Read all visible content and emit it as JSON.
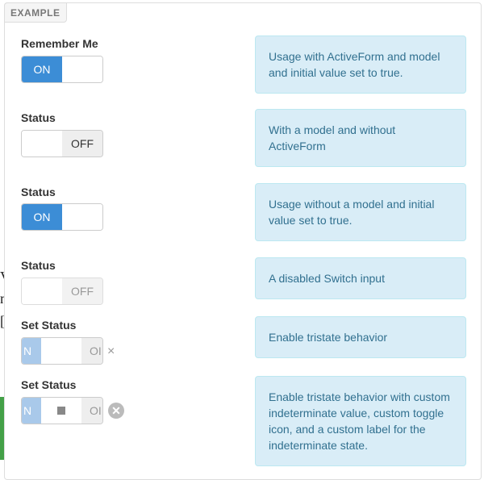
{
  "panel": {
    "tag": "EXAMPLE"
  },
  "rows": [
    {
      "label": "Remember Me",
      "on_text": "ON",
      "off_text": "",
      "note": "Usage with ActiveForm and model and initial value set to true."
    },
    {
      "label": "Status",
      "on_text": "",
      "off_text": "OFF",
      "note": "With a model and without ActiveForm"
    },
    {
      "label": "Status",
      "on_text": "ON",
      "off_text": "",
      "note": "Usage without a model and initial value set to true."
    },
    {
      "label": "Status",
      "on_text": "",
      "off_text": "OFF",
      "note": "A disabled Switch input"
    },
    {
      "label": "Set Status",
      "on_text": "N",
      "off_text": "OI",
      "clear": "×",
      "note": "Enable tristate behavior"
    },
    {
      "label": "Set Status",
      "on_text": "N",
      "off_text": "OI",
      "clear": "✕",
      "note": "Enable tristate behavior with custom indeterminate value, custom toggle icon, and a custom label for the indeterminate state."
    }
  ],
  "background": {
    "frag1": "V",
    "frag2": "n",
    "frag3": "["
  },
  "icons": {
    "clear1": "close-icon",
    "clear2": "close-circle-icon",
    "toggle": "stop-square-icon"
  },
  "colors": {
    "switch_on": "#3c8dd6",
    "note_bg": "#d9edf7",
    "note_text": "#31708f"
  }
}
